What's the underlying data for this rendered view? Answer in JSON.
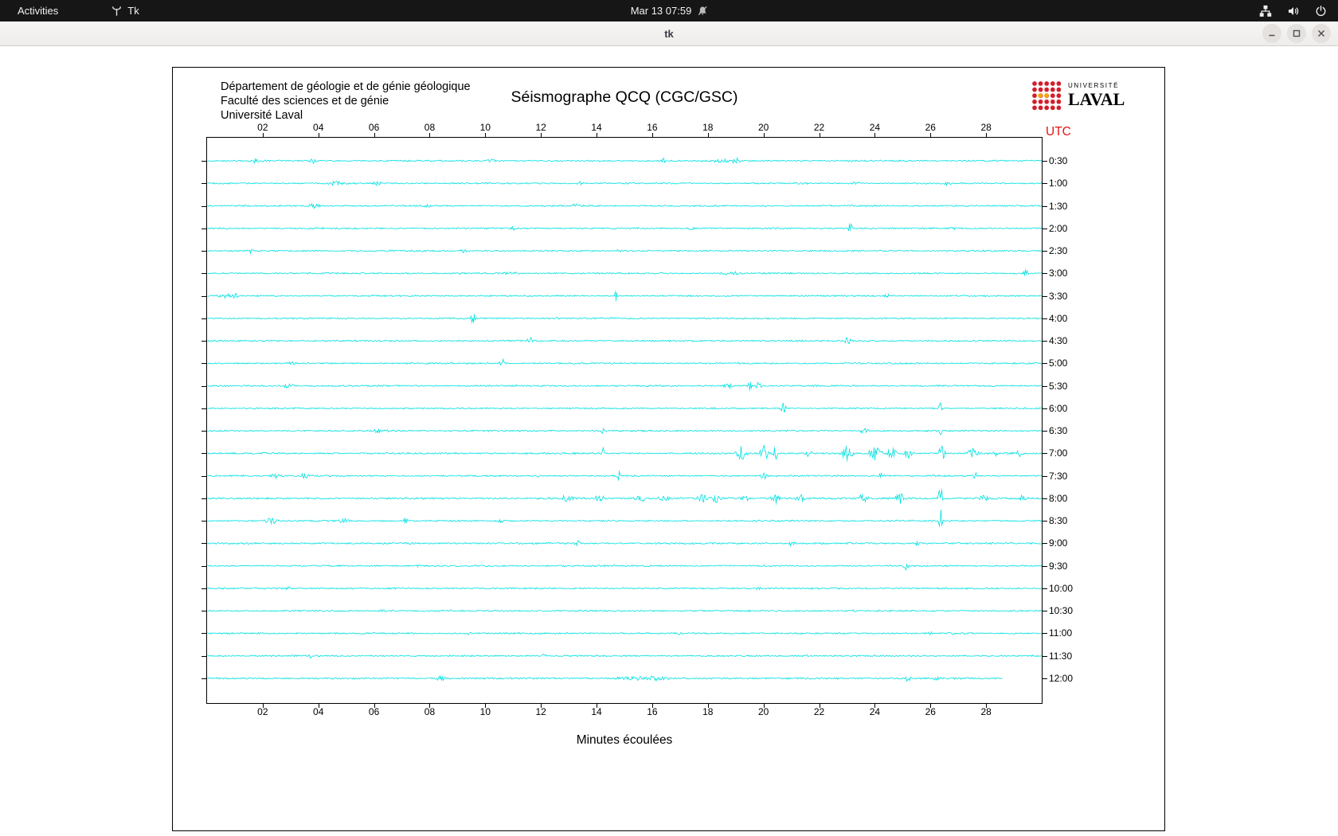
{
  "top_bar": {
    "activities_label": "Activities",
    "app_name": "Tk",
    "clock": "Mar 13 07:59"
  },
  "window": {
    "title": "tk"
  },
  "panel": {
    "institution_lines": [
      "Département de géologie et de génie géologique",
      "Faculté des sciences et de génie",
      "Université Laval"
    ],
    "title": "Séismographe QCQ (CGC/GSC)",
    "logo": {
      "small": "UNIVERSITÉ",
      "large": "LAVAL"
    },
    "utc_label": "UTC",
    "utc_color": "#e41414",
    "xlabel": "Minutes écoulées"
  },
  "chart_data": {
    "type": "line",
    "title": "Séismographe QCQ (CGC/GSC)",
    "xlabel": "Minutes écoulées",
    "ylabel": "UTC",
    "x_range_minutes": [
      0,
      30
    ],
    "x_ticks": [
      "02",
      "04",
      "06",
      "08",
      "10",
      "12",
      "14",
      "16",
      "18",
      "20",
      "22",
      "24",
      "26",
      "28"
    ],
    "trace_color": "#00e0e0",
    "row_interval_minutes": 30,
    "rows": [
      {
        "label": "0:30",
        "bursts": [
          [
            1.7,
            0.2,
            2
          ],
          [
            3.8,
            0.25,
            2.5
          ],
          [
            10.2,
            0.2,
            2
          ],
          [
            16.4,
            0.15,
            3
          ],
          [
            18.6,
            0.5,
            2.5
          ],
          [
            19,
            0.15,
            3
          ]
        ]
      },
      {
        "label": "1:00",
        "bursts": [
          [
            4.6,
            0.3,
            2.5
          ],
          [
            6.1,
            0.2,
            2
          ],
          [
            13.4,
            0.15,
            2
          ],
          [
            23.3,
            0.2,
            2.5
          ],
          [
            26.6,
            0.12,
            5
          ]
        ]
      },
      {
        "label": "1:30",
        "bursts": [
          [
            3.8,
            0.3,
            3
          ],
          [
            7.9,
            0.15,
            2
          ],
          [
            13.2,
            0.15,
            2.5
          ],
          [
            20,
            0.1,
            2
          ]
        ]
      },
      {
        "label": "2:00",
        "bursts": [
          [
            11,
            0.2,
            2
          ],
          [
            17.4,
            0.15,
            2
          ],
          [
            23.1,
            0.15,
            6
          ],
          [
            26.8,
            0.1,
            2
          ]
        ]
      },
      {
        "label": "2:30",
        "bursts": [
          [
            1.6,
            0.12,
            4
          ],
          [
            9.2,
            0.15,
            2
          ],
          [
            14.8,
            0.1,
            2
          ]
        ]
      },
      {
        "label": "3:00",
        "bursts": [
          [
            10.9,
            0.3,
            2
          ],
          [
            18.8,
            0.5,
            2.5
          ],
          [
            29.4,
            0.12,
            7
          ]
        ]
      },
      {
        "label": "3:30",
        "bursts": [
          [
            0.6,
            0.3,
            3
          ],
          [
            1,
            0.15,
            3
          ],
          [
            14.7,
            0.1,
            8
          ],
          [
            24.4,
            0.12,
            4
          ]
        ]
      },
      {
        "label": "4:00",
        "bursts": [
          [
            9.55,
            0.1,
            10
          ],
          [
            12.5,
            0.2,
            1.5
          ]
        ]
      },
      {
        "label": "4:30",
        "bursts": [
          [
            11.6,
            0.15,
            4
          ],
          [
            23,
            0.12,
            9
          ]
        ]
      },
      {
        "label": "5:00",
        "bursts": [
          [
            3,
            0.3,
            1.5
          ],
          [
            10.6,
            0.12,
            7
          ]
        ]
      },
      {
        "label": "5:30",
        "bursts": [
          [
            2.9,
            0.3,
            2.5
          ],
          [
            18.7,
            0.2,
            4
          ],
          [
            19.5,
            0.15,
            5
          ],
          [
            19.8,
            0.15,
            5
          ]
        ]
      },
      {
        "label": "6:00",
        "bursts": [
          [
            20.7,
            0.12,
            8
          ],
          [
            26.35,
            0.09,
            12
          ]
        ]
      },
      {
        "label": "6:30",
        "bursts": [
          [
            6.2,
            0.4,
            2
          ],
          [
            14.2,
            0.15,
            3
          ],
          [
            23.6,
            0.2,
            4
          ],
          [
            26.35,
            0.08,
            6
          ]
        ]
      },
      {
        "label": "7:00",
        "base": 0.8,
        "bursts": [
          [
            14.2,
            0.07,
            13
          ],
          [
            19.2,
            0.25,
            9
          ],
          [
            20,
            0.2,
            12
          ],
          [
            20.4,
            0.15,
            9
          ],
          [
            21.6,
            0.15,
            5
          ],
          [
            23,
            0.25,
            10
          ],
          [
            24,
            0.3,
            8
          ],
          [
            24.6,
            0.25,
            8
          ],
          [
            25.2,
            0.2,
            6
          ],
          [
            26.4,
            0.12,
            30
          ],
          [
            27.5,
            0.25,
            6
          ],
          [
            28.3,
            0.15,
            4
          ],
          [
            29.2,
            0.15,
            5
          ]
        ]
      },
      {
        "label": "7:30",
        "bursts": [
          [
            2.5,
            0.3,
            3
          ],
          [
            3.5,
            0.2,
            4
          ],
          [
            11.9,
            0.1,
            3
          ],
          [
            14.8,
            0.1,
            6
          ],
          [
            20,
            0.15,
            6
          ],
          [
            24.2,
            0.15,
            3
          ],
          [
            27.6,
            0.12,
            4
          ]
        ]
      },
      {
        "label": "8:00",
        "base": 0.9,
        "bursts": [
          [
            12.9,
            0.3,
            4
          ],
          [
            14.1,
            0.25,
            4
          ],
          [
            15.6,
            0.3,
            4
          ],
          [
            16.4,
            0.25,
            4
          ],
          [
            17.8,
            0.25,
            6
          ],
          [
            18.3,
            0.2,
            6
          ],
          [
            19.3,
            0.2,
            5
          ],
          [
            20.4,
            0.2,
            7
          ],
          [
            21.3,
            0.2,
            5
          ],
          [
            23.6,
            0.2,
            8
          ],
          [
            24.9,
            0.25,
            6
          ],
          [
            26.35,
            0.1,
            24
          ],
          [
            27.9,
            0.2,
            4
          ],
          [
            29.3,
            0.12,
            6
          ]
        ]
      },
      {
        "label": "8:30",
        "bursts": [
          [
            2.3,
            0.3,
            4
          ],
          [
            4.9,
            0.2,
            3
          ],
          [
            7.1,
            0.15,
            3
          ],
          [
            10.5,
            0.2,
            2
          ],
          [
            26.35,
            0.09,
            18
          ]
        ]
      },
      {
        "label": "9:00",
        "base": 0.8,
        "bursts": [
          [
            13.3,
            0.15,
            3
          ],
          [
            21,
            0.12,
            4
          ],
          [
            25.5,
            0.15,
            2
          ]
        ]
      },
      {
        "label": "9:30",
        "bursts": [
          [
            7.5,
            0.2,
            1.5
          ],
          [
            25.1,
            0.12,
            6
          ]
        ]
      },
      {
        "label": "10:00",
        "bursts": [
          [
            2.9,
            0.2,
            1.5
          ],
          [
            19.8,
            0.15,
            1.5
          ]
        ]
      },
      {
        "label": "10:30",
        "bursts": [
          [
            6.3,
            0.15,
            1.5
          ],
          [
            23.2,
            0.1,
            1.5
          ]
        ]
      },
      {
        "label": "11:00",
        "bursts": [
          [
            9.4,
            0.15,
            1.5
          ],
          [
            17,
            0.2,
            1.5
          ],
          [
            26,
            0.1,
            2
          ]
        ]
      },
      {
        "label": "11:30",
        "bursts": [
          [
            3.7,
            0.1,
            4
          ],
          [
            12.1,
            0.15,
            2
          ],
          [
            21.5,
            0.15,
            2
          ]
        ]
      },
      {
        "label": "12:00",
        "base": 0.8,
        "end": 0.952,
        "bursts": [
          [
            8.4,
            0.3,
            2.5
          ],
          [
            15.5,
            1.2,
            1.8
          ],
          [
            16.2,
            0.3,
            2.5
          ],
          [
            25.2,
            0.12,
            6
          ],
          [
            26.2,
            0.12,
            4
          ]
        ]
      }
    ]
  }
}
